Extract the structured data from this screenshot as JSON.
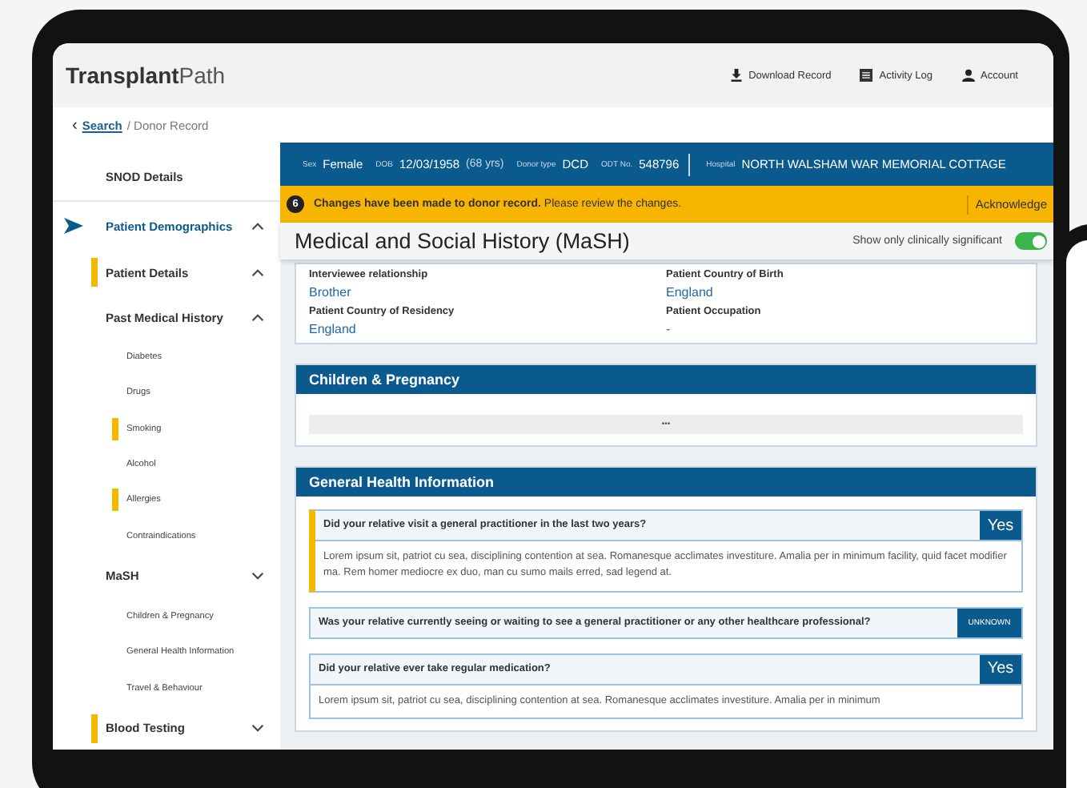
{
  "app": {
    "logo_bold": "Transplant",
    "logo_light": "Path",
    "actions": [
      {
        "label": "Download Record"
      },
      {
        "label": "Activity Log"
      },
      {
        "label": "Account"
      }
    ]
  },
  "breadcrumb": {
    "back": "‹",
    "link": "Search",
    "current": "/ Donor Record"
  },
  "sidebar": {
    "items": [
      {
        "label": "SNOD Details",
        "selected": false,
        "flagged": false
      },
      {
        "label": "Patient Demographics",
        "selected": true,
        "flagged": false,
        "expanded": true,
        "children": [
          {
            "label": "Patient Details",
            "selected": false,
            "flagged": true,
            "expanded": true
          },
          {
            "label": "Past Medical History",
            "selected": false,
            "flagged": false,
            "expanded": true,
            "children": [
              {
                "label": "Diabetes",
                "selected": false,
                "flagged": false
              },
              {
                "label": "Drugs",
                "selected": false,
                "flagged": false
              },
              {
                "label": "Smoking",
                "selected": false,
                "flagged": true
              },
              {
                "label": "Alcohol",
                "selected": false,
                "flagged": false
              },
              {
                "label": "Allergies",
                "selected": false,
                "flagged": true
              },
              {
                "label": "Contraindications",
                "selected": false,
                "flagged": false
              }
            ]
          },
          {
            "label": "MaSH",
            "selected": false,
            "flagged": false,
            "expanded": false,
            "children": [
              {
                "label": "Children & Pregnancy",
                "selected": false,
                "flagged": false
              },
              {
                "label": "General Health Information",
                "selected": false,
                "flagged": false
              },
              {
                "label": "Travel & Behaviour",
                "selected": false,
                "flagged": false
              }
            ]
          },
          {
            "label": "Blood Testing",
            "selected": false,
            "flagged": true,
            "expanded": false
          }
        ]
      }
    ]
  },
  "patient_bar": {
    "fields": [
      {
        "label": "Sex",
        "value": "Female"
      },
      {
        "label": "DOB",
        "value": "12/03/1958",
        "note": "(68 yrs)"
      },
      {
        "label": "Donor type",
        "value": "DCD"
      },
      {
        "label": "ODT No.",
        "value": "548796"
      },
      {
        "label": "Hospital",
        "value": "NORTH WALSHAM WAR MEMORIAL COTTAGE"
      }
    ]
  },
  "alert": {
    "count": "6",
    "message": "**Changes have been made to donor record.** Please review the changes.",
    "action": "Acknowledge"
  },
  "section": {
    "title": "Medical and Social History (MaSH)",
    "toggle": {
      "label": "Show only clinically significant",
      "on": true
    }
  },
  "details_card": {
    "fields": [
      {
        "label": "Interviewee relationship",
        "value": "Brother"
      },
      {
        "label": "Patient Country of Birth",
        "value": "England"
      },
      {
        "label": "Patient Country of Residency",
        "value": "England"
      },
      {
        "label": "Patient Occupation",
        "value": "-"
      }
    ]
  },
  "children_pregnancy": {
    "title": "Children & Pregnancy",
    "expander": "•••"
  },
  "general_health": {
    "title": "General Health Information",
    "questions": [
      {
        "question": "Did your relative visit a general practitioner in the last two years?",
        "answer": "Yes",
        "kind": "answered",
        "flagged": true,
        "comment": "Lorem ipsum sit, patriot cu sea, disciplining contention at sea. Romanesque acclimates investiture. Amalia per in minimum facility, quid facet modifier ma. Rem homer mediocre ex duo, man cu sumo mails erred, sad legend at."
      },
      {
        "question": "Was your relative currently seeing or waiting to see a general practitioner or any other healthcare professional?",
        "answer": "UNKNOWN",
        "kind": "unknown",
        "flagged": false
      },
      {
        "question": "Did your relative ever take regular medication?",
        "answer": "Yes",
        "kind": "answered",
        "flagged": false,
        "comment": "Lorem ipsum sit, patriot cu sea, disciplining contention at sea. Romanesque acclimates investiture. Amalia per in minimum"
      }
    ]
  }
}
